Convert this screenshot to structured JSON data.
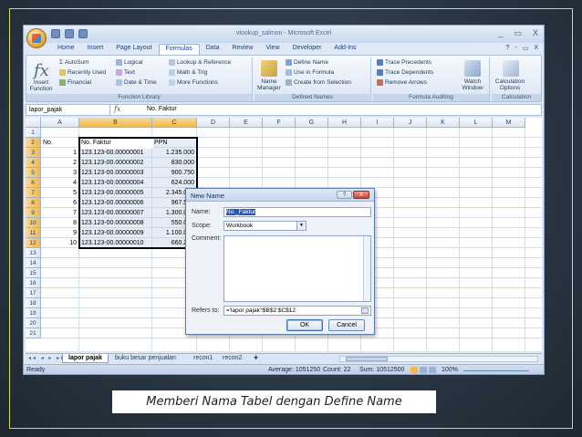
{
  "window": {
    "title": "vlookup_salmon - Microsoft Excel",
    "controls": [
      "_",
      "▭",
      "X"
    ]
  },
  "ribbon_tabs": [
    "Home",
    "Insert",
    "Page Layout",
    "Formulas",
    "Data",
    "Review",
    "View",
    "Developer",
    "Add-Ins"
  ],
  "active_tab": "Formulas",
  "ribbon_right": [
    "?",
    "-",
    "▭",
    "X"
  ],
  "ribbon": {
    "insert_function": "Insert\nFunction",
    "function_library": {
      "label": "Function Library",
      "autosum": "Σ AutoSum",
      "recently_used": "Recently Used",
      "financial": "Financial",
      "logical": "Logical",
      "text": "Text",
      "date_time": "Date & Time",
      "lookup_reference": "Lookup & Reference",
      "math_trig": "Math & Trig",
      "more_functions": "More Functions"
    },
    "defined_names": {
      "label": "Defined Names",
      "name_manager": "Name\nManager",
      "define_name": "Define Name",
      "use_in_formula": "Use in Formula",
      "create_from_selection": "Create from Selection"
    },
    "formula_auditing": {
      "label": "Formula Auditing",
      "trace_precedents": "Trace Precedents",
      "trace_dependents": "Trace Dependents",
      "remove_arrows": "Remove Arrows",
      "watch_window": "Watch\nWindow"
    },
    "calculation": {
      "label": "Calculation",
      "calculation_options": "Calculation\nOptions"
    }
  },
  "formula_bar": {
    "name_box": "lapor_pajak",
    "fx": "fx",
    "content": "No. Faktur"
  },
  "columns": [
    "A",
    "B",
    "C",
    "D",
    "E",
    "F",
    "G",
    "H",
    "I",
    "J",
    "K",
    "L",
    "M"
  ],
  "rows": [
    "1",
    "2",
    "3",
    "4",
    "5",
    "6",
    "7",
    "8",
    "9",
    "10",
    "11",
    "12",
    "13",
    "14",
    "15",
    "16",
    "17",
    "18",
    "19",
    "20",
    "21"
  ],
  "table": {
    "header": {
      "a": "No.",
      "b": "No. Faktur",
      "c": "PPN"
    },
    "rows": [
      {
        "no": "1",
        "faktur": "123.123-00.00000001",
        "ppn": "1.235.000"
      },
      {
        "no": "2",
        "faktur": "123.123-00.00000002",
        "ppn": "830.000"
      },
      {
        "no": "3",
        "faktur": "123.123-00.00000003",
        "ppn": "900.750"
      },
      {
        "no": "4",
        "faktur": "123.123-00.00000004",
        "ppn": "624.000"
      },
      {
        "no": "5",
        "faktur": "123.123-00.00000005",
        "ppn": "2.345.000"
      },
      {
        "no": "6",
        "faktur": "123.123-00.00000006",
        "ppn": "967.500"
      },
      {
        "no": "7",
        "faktur": "123.123-00.00000007",
        "ppn": "1.300.000"
      },
      {
        "no": "8",
        "faktur": "123.123-00.00000008",
        "ppn": "550.000"
      },
      {
        "no": "9",
        "faktur": "123.123-00.00000009",
        "ppn": "1.100.000"
      },
      {
        "no": "10",
        "faktur": "123.123-00.00000010",
        "ppn": "660.250"
      }
    ]
  },
  "sheet_tabs": {
    "arrows": "◂◂ ◂ ▸ ▸▸",
    "tabs": [
      "lapor pajak",
      "buku besar penjualan",
      "recon1",
      "recon2"
    ],
    "active": "lapor pajak"
  },
  "status_bar": {
    "ready": "Ready",
    "average": "Average: 1051250",
    "count": "Count: 22",
    "sum": "Sum: 10512500",
    "zoom": "100%"
  },
  "dialog": {
    "title": "New Name",
    "help": "?",
    "close": "X",
    "name_label": "Name:",
    "name_value": "No._Faktur",
    "scope_label": "Scope:",
    "scope_value": "Workbook",
    "comment_label": "Comment:",
    "refers_label": "Refers to:",
    "refers_value": "='lapor pajak'!$B$2:$C$12",
    "ok": "OK",
    "cancel": "Cancel"
  },
  "caption": "Memberi Nama Tabel dengan Define Name",
  "colors": {
    "frame_border": "#d8d860",
    "background": "#2a3844",
    "active_tab": "#ffffff",
    "selection_header": "#f1b94d",
    "dialog_close": "#c7462f"
  }
}
